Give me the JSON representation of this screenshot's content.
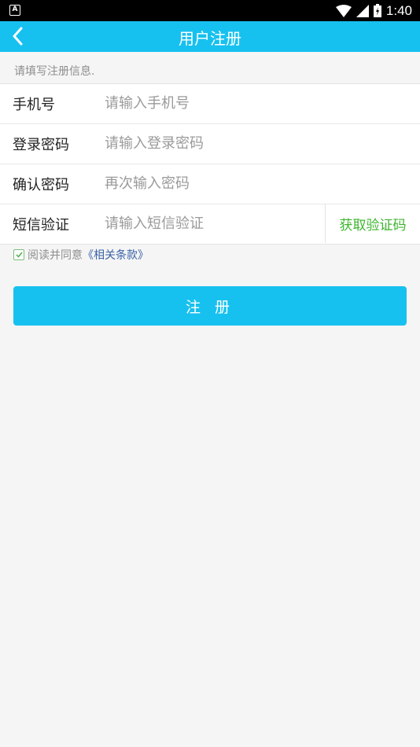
{
  "status_bar": {
    "app_icon_letter": "A",
    "time": "1:40"
  },
  "nav": {
    "title": "用户注册"
  },
  "hint": "请填写注册信息.",
  "form": {
    "rows": [
      {
        "label": "手机号",
        "placeholder": "请输入手机号",
        "value": ""
      },
      {
        "label": "登录密码",
        "placeholder": "请输入登录密码",
        "value": ""
      },
      {
        "label": "确认密码",
        "placeholder": "再次输入密码",
        "value": ""
      },
      {
        "label": "短信验证",
        "placeholder": "请输入短信验证",
        "value": ""
      }
    ],
    "sms_button_label": "获取验证码"
  },
  "agreement": {
    "checked": true,
    "text": "阅读并同意",
    "link_text": "《相关条款》"
  },
  "register_button_label": "注 册",
  "colors": {
    "accent": "#17c1ef",
    "sms_text": "#3cb52d",
    "link": "#3a62a8"
  }
}
